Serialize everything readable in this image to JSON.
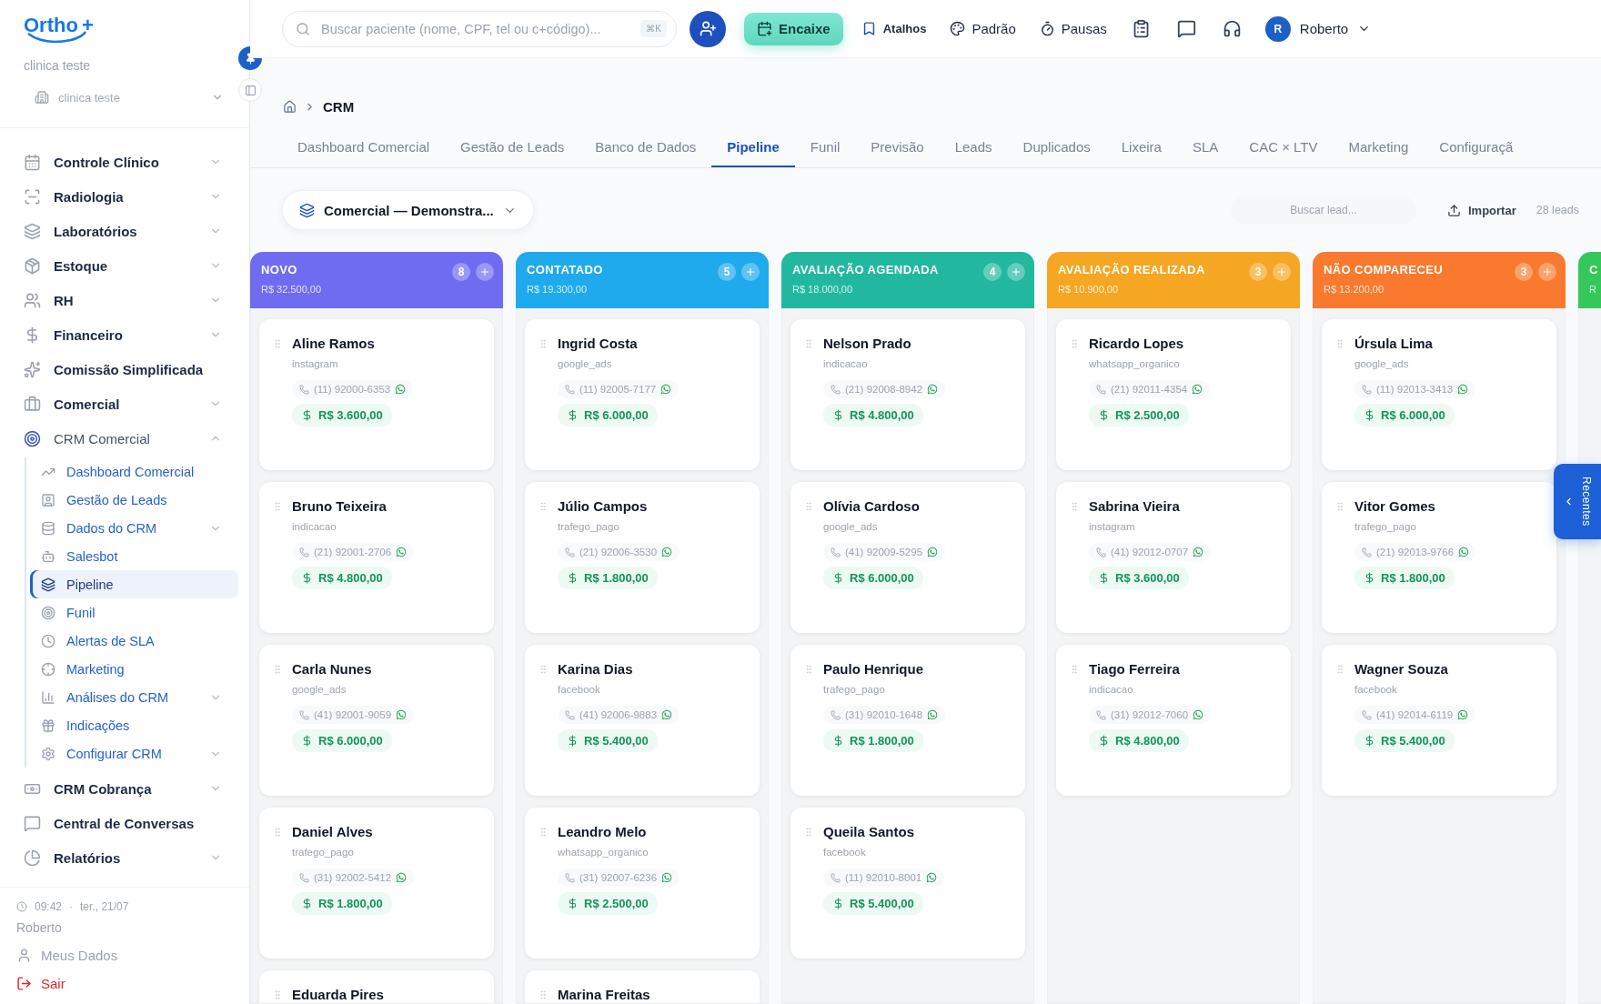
{
  "sidebar": {
    "logo": "Ortho",
    "logo_mark": "+",
    "clinic_name": "clinica teste",
    "clinic_select": "clinica teste",
    "items": [
      {
        "label": "Controle Clínico",
        "expanded": false
      },
      {
        "label": "Radiologia",
        "expanded": false
      },
      {
        "label": "Laboratórios",
        "expanded": false
      },
      {
        "label": "Estoque",
        "expanded": false
      },
      {
        "label": "RH",
        "expanded": false
      },
      {
        "label": "Financeiro",
        "expanded": false
      },
      {
        "label": "Comissão Simplificada"
      },
      {
        "label": "Comercial",
        "expanded": false
      },
      {
        "label": "CRM Comercial",
        "expanded": true,
        "children": [
          {
            "label": "Dashboard Comercial",
            "selected": false
          },
          {
            "label": "Gestão de Leads",
            "selected": false
          },
          {
            "label": "Dados do CRM",
            "selected": false,
            "expanded": false
          },
          {
            "label": "Salesbot",
            "selected": false
          },
          {
            "label": "Pipeline",
            "selected": true
          },
          {
            "label": "Funil",
            "selected": false
          },
          {
            "label": "Alertas de SLA",
            "selected": false
          },
          {
            "label": "Marketing",
            "selected": false
          },
          {
            "label": "Análises do CRM",
            "selected": false,
            "expanded": false
          },
          {
            "label": "Indicações",
            "selected": false
          },
          {
            "label": "Configurar CRM",
            "selected": false,
            "expanded": false
          }
        ]
      },
      {
        "label": "CRM Cobrança",
        "expanded": false
      },
      {
        "label": "Central de Conversas"
      },
      {
        "label": "Relatórios",
        "expanded": false
      }
    ],
    "footer": {
      "time": "09:42",
      "separator": "·",
      "date": "ter., 21/07",
      "user": "Roberto",
      "my_data": "Meus Dados",
      "logout": "Sair"
    }
  },
  "topbar": {
    "search": {
      "placeholder": "Buscar paciente (nome, CPF, tel ou c+código)...",
      "shortcut": "⌘K"
    },
    "encaixe": "Encaixe",
    "atalhos": "Atalhos",
    "padrao": "Padrão",
    "pausas": "Pausas",
    "user_initial": "R",
    "user_name": "Roberto"
  },
  "breadcrumb": [
    "CRM"
  ],
  "tabs": [
    {
      "label": "Dashboard Comercial",
      "selected": false
    },
    {
      "label": "Gestão de Leads",
      "selected": false
    },
    {
      "label": "Banco de Dados",
      "selected": false
    },
    {
      "label": "Pipeline",
      "selected": true
    },
    {
      "label": "Funil",
      "selected": false
    },
    {
      "label": "Previsão",
      "selected": false
    },
    {
      "label": "Leads",
      "selected": false
    },
    {
      "label": "Duplicados",
      "selected": false
    },
    {
      "label": "Lixeira",
      "selected": false
    },
    {
      "label": "SLA",
      "selected": false
    },
    {
      "label": "CAC × LTV",
      "selected": false
    },
    {
      "label": "Marketing",
      "selected": false
    },
    {
      "label": "Configuraçã",
      "selected": false
    }
  ],
  "toolbar": {
    "pipeline": "Comercial — Demonstra...",
    "search": {
      "placeholder": "Buscar lead..."
    },
    "import": "Importar",
    "count": "28 leads"
  },
  "columns": [
    {
      "title": "NOVO",
      "total": "R$ 32.500,00",
      "count": "8",
      "color": "#6f6cf2",
      "cards": [
        {
          "name": "Aline Ramos",
          "source": "instagram",
          "phone": "(11) 92000-6353",
          "value": "R$ 3.600,00"
        },
        {
          "name": "Bruno Teixeira",
          "source": "indicacao",
          "phone": "(21) 92001-2706",
          "value": "R$ 4.800,00"
        },
        {
          "name": "Carla Nunes",
          "source": "google_ads",
          "phone": "(41) 92001-9059",
          "value": "R$ 6.000,00"
        },
        {
          "name": "Daniel Alves",
          "source": "trafego_pago",
          "phone": "(31) 92002-5412",
          "value": "R$ 1.800,00"
        },
        {
          "name": "Eduarda Pires"
        }
      ]
    },
    {
      "title": "CONTATADO",
      "total": "R$ 19.300,00",
      "count": "5",
      "color": "#1eaaec",
      "cards": [
        {
          "name": "Ingrid Costa",
          "source": "google_ads",
          "phone": "(11) 92005-7177",
          "value": "R$ 6.000,00"
        },
        {
          "name": "Júlio Campos",
          "source": "trafego_pago",
          "phone": "(21) 92006-3530",
          "value": "R$ 1.800,00"
        },
        {
          "name": "Karina Dias",
          "source": "facebook",
          "phone": "(41) 92006-9883",
          "value": "R$ 5.400,00"
        },
        {
          "name": "Leandro Melo",
          "source": "whatsapp_organico",
          "phone": "(31) 92007-6236",
          "value": "R$ 2.500,00"
        },
        {
          "name": "Marina Freitas"
        }
      ]
    },
    {
      "title": "AVALIAÇÃO AGENDADA",
      "total": "R$ 18.000,00",
      "count": "4",
      "color": "#22b8a0",
      "cards": [
        {
          "name": "Nelson Prado",
          "source": "indicacao",
          "phone": "(21) 92008-8942",
          "value": "R$ 4.800,00"
        },
        {
          "name": "Olívia Cardoso",
          "source": "google_ads",
          "phone": "(41) 92009-5295",
          "value": "R$ 6.000,00"
        },
        {
          "name": "Paulo Henrique",
          "source": "trafego_pago",
          "phone": "(31) 92010-1648",
          "value": "R$ 1.800,00"
        },
        {
          "name": "Queila Santos",
          "source": "facebook",
          "phone": "(11) 92010-8001",
          "value": "R$ 5.400,00"
        }
      ]
    },
    {
      "title": "AVALIAÇÃO REALIZADA",
      "total": "R$ 10.900,00",
      "count": "3",
      "color": "#f5a623",
      "cards": [
        {
          "name": "Ricardo Lopes",
          "source": "whatsapp_organico",
          "phone": "(21) 92011-4354",
          "value": "R$ 2.500,00"
        },
        {
          "name": "Sabrina Vieira",
          "source": "instagram",
          "phone": "(41) 92012-0707",
          "value": "R$ 3.600,00"
        },
        {
          "name": "Tiago Ferreira",
          "source": "indicacao",
          "phone": "(31) 92012-7060",
          "value": "R$ 4.800,00"
        }
      ]
    },
    {
      "title": "NÃO COMPARECEU",
      "total": "R$ 13.200,00",
      "count": "3",
      "color": "#f97a2e",
      "cards": [
        {
          "name": "Úrsula Lima",
          "source": "google_ads",
          "phone": "(11) 92013-3413",
          "value": "R$ 6.000,00"
        },
        {
          "name": "Vitor Gomes",
          "source": "trafego_pago",
          "phone": "(21) 92013-9766",
          "value": "R$ 1.800,00"
        },
        {
          "name": "Wagner Souza",
          "source": "facebook",
          "phone": "(41) 92014-6119",
          "value": "R$ 5.400,00"
        }
      ]
    },
    {
      "title": "C",
      "total": "R",
      "color": "#34c759"
    }
  ],
  "recent_tab": "Recentes"
}
